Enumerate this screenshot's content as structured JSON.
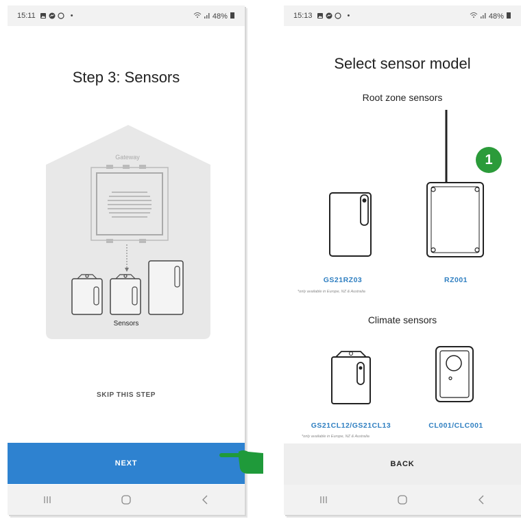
{
  "left_screen": {
    "status": {
      "time": "15:11",
      "right": "48%"
    },
    "title": "Step 3: Sensors",
    "illustration": {
      "gateway_label": "Gateway",
      "sensors_label": "Sensors"
    },
    "skip_label": "SKIP THIS STEP",
    "next_label": "NEXT"
  },
  "right_screen": {
    "status": {
      "time": "15:13",
      "right": "48%"
    },
    "title": "Select sensor model",
    "root_zone_title": "Root zone sensors",
    "climate_title": "Climate sensors",
    "models": [
      {
        "label": "GS21RZ03",
        "note": "*only available in Europe, NZ & Australia"
      },
      {
        "label": "RZ001",
        "note": ""
      },
      {
        "label": "GS21CL12/GS21CL13",
        "note": "*only available in Europe, NZ & Australia"
      },
      {
        "label": "CL001/CLC001",
        "note": ""
      }
    ],
    "badge": "1",
    "back_label": "BACK"
  },
  "colors": {
    "accent": "#2e82d0",
    "link": "#2f7fc1",
    "badge": "#2b9b3a",
    "pointer": "#1f9a3a"
  },
  "icons": [
    "image-icon",
    "messenger-icon",
    "whatsapp-icon",
    "wifi-icon",
    "signal-icon",
    "battery-icon",
    "recents-icon",
    "home-icon",
    "back-icon",
    "pointing-hand-icon"
  ]
}
